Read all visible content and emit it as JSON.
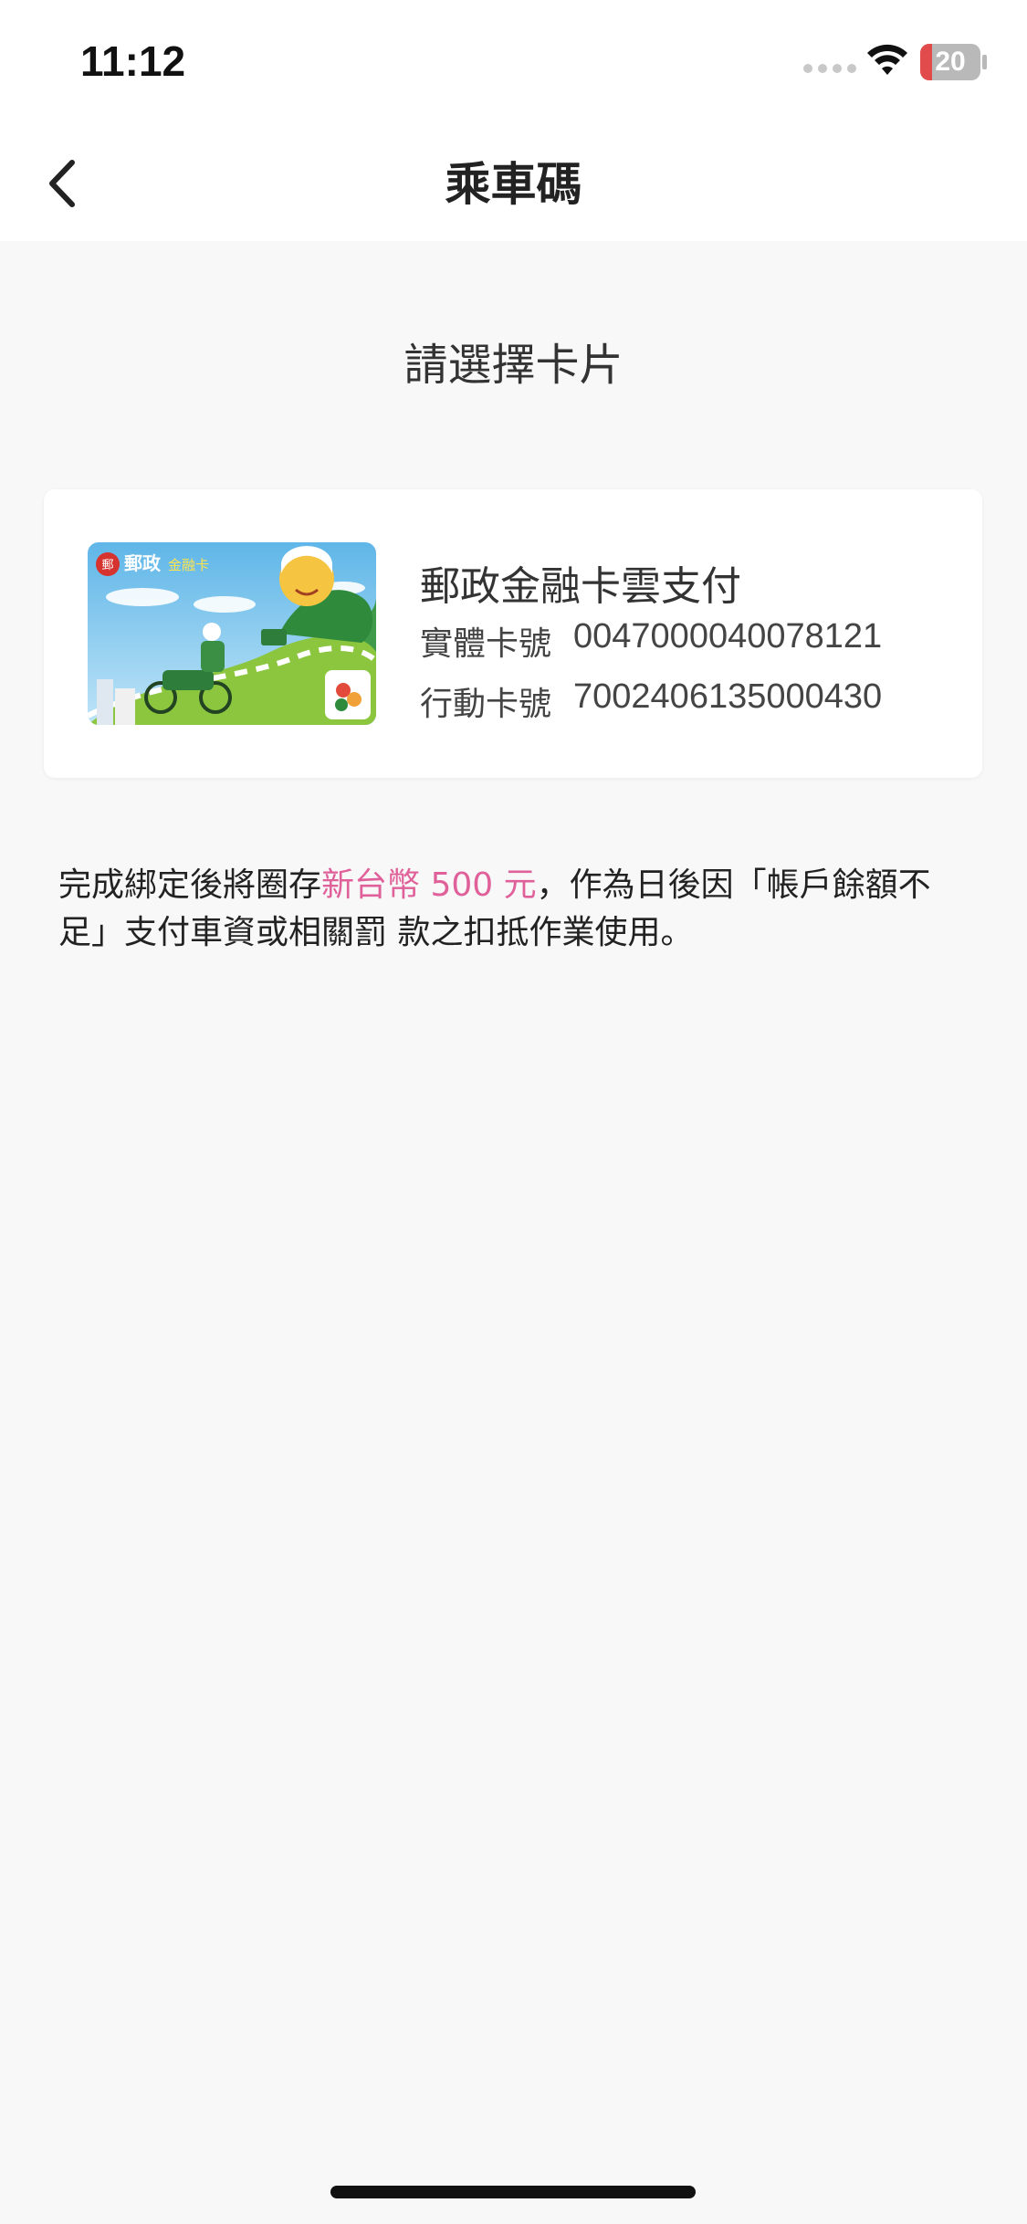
{
  "status_bar": {
    "time": "11:12",
    "battery": "20"
  },
  "nav": {
    "title": "乘車碼"
  },
  "section_title": "請選擇卡片",
  "card": {
    "name": "郵政金融卡雲支付",
    "physical_label": "實體卡號",
    "physical_number": "0047000040078121",
    "mobile_label": "行動卡號",
    "mobile_number": "7002406135000430",
    "image_text": {
      "brand": "郵政",
      "card_type": "金融卡"
    }
  },
  "notice": {
    "prefix": "完成綁定後將圈存",
    "highlight": "新台幣 500 元",
    "suffix": "，作為日後因「帳戶餘額不足」支付車資或相關罰 款之扣抵作業使用。"
  },
  "colors": {
    "highlight": "#e0609a",
    "battery_low": "#e14b4b"
  }
}
